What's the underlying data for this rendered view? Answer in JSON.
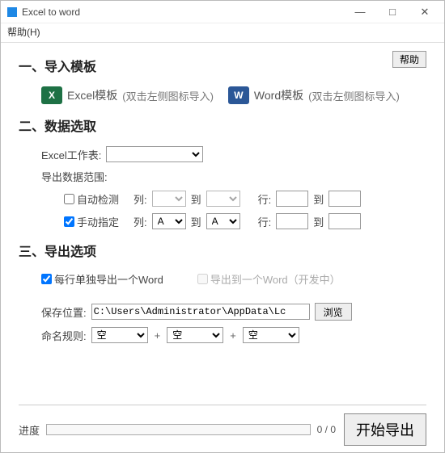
{
  "window": {
    "title": "Excel to word",
    "min": "—",
    "max": "□",
    "close": "✕"
  },
  "menu": {
    "help": "帮助(H)"
  },
  "sec1": {
    "title": "一、导入模板",
    "help_btn": "帮助",
    "excel_label": "Excel模板",
    "excel_hint": "(双击左侧图标导入)",
    "excel_icon_glyph": "X",
    "word_label": "Word模板",
    "word_hint": "(双击左侧图标导入)",
    "word_icon_glyph": "W"
  },
  "sec2": {
    "title": "二、数据选取",
    "sheet_label": "Excel工作表:",
    "sheet_value": "",
    "range_label": "导出数据范围:",
    "auto_label": "自动检测",
    "auto_checked": false,
    "manual_label": "手动指定",
    "manual_checked": true,
    "col_label": "列:",
    "to_label": "到",
    "row_label": "行:",
    "auto_col_from": "",
    "auto_col_to": "",
    "auto_row_from": "",
    "auto_row_to": "",
    "man_col_from": "A",
    "man_col_to": "A",
    "man_row_from": "",
    "man_row_to": ""
  },
  "sec3": {
    "title": "三、导出选项",
    "each_row_label": "每行单独导出一个Word",
    "each_row_checked": true,
    "single_word_label": "导出到一个Word（开发中）",
    "single_word_checked": false,
    "save_loc_label": "保存位置:",
    "save_loc_value": "C:\\Users\\Administrator\\AppData\\Lc",
    "browse_btn": "浏览",
    "name_rule_label": "命名规则:",
    "name_rule_opt": "空",
    "plus": "+"
  },
  "footer": {
    "progress_label": "进度",
    "progress_text": "0 / 0",
    "start_btn": "开始导出"
  }
}
